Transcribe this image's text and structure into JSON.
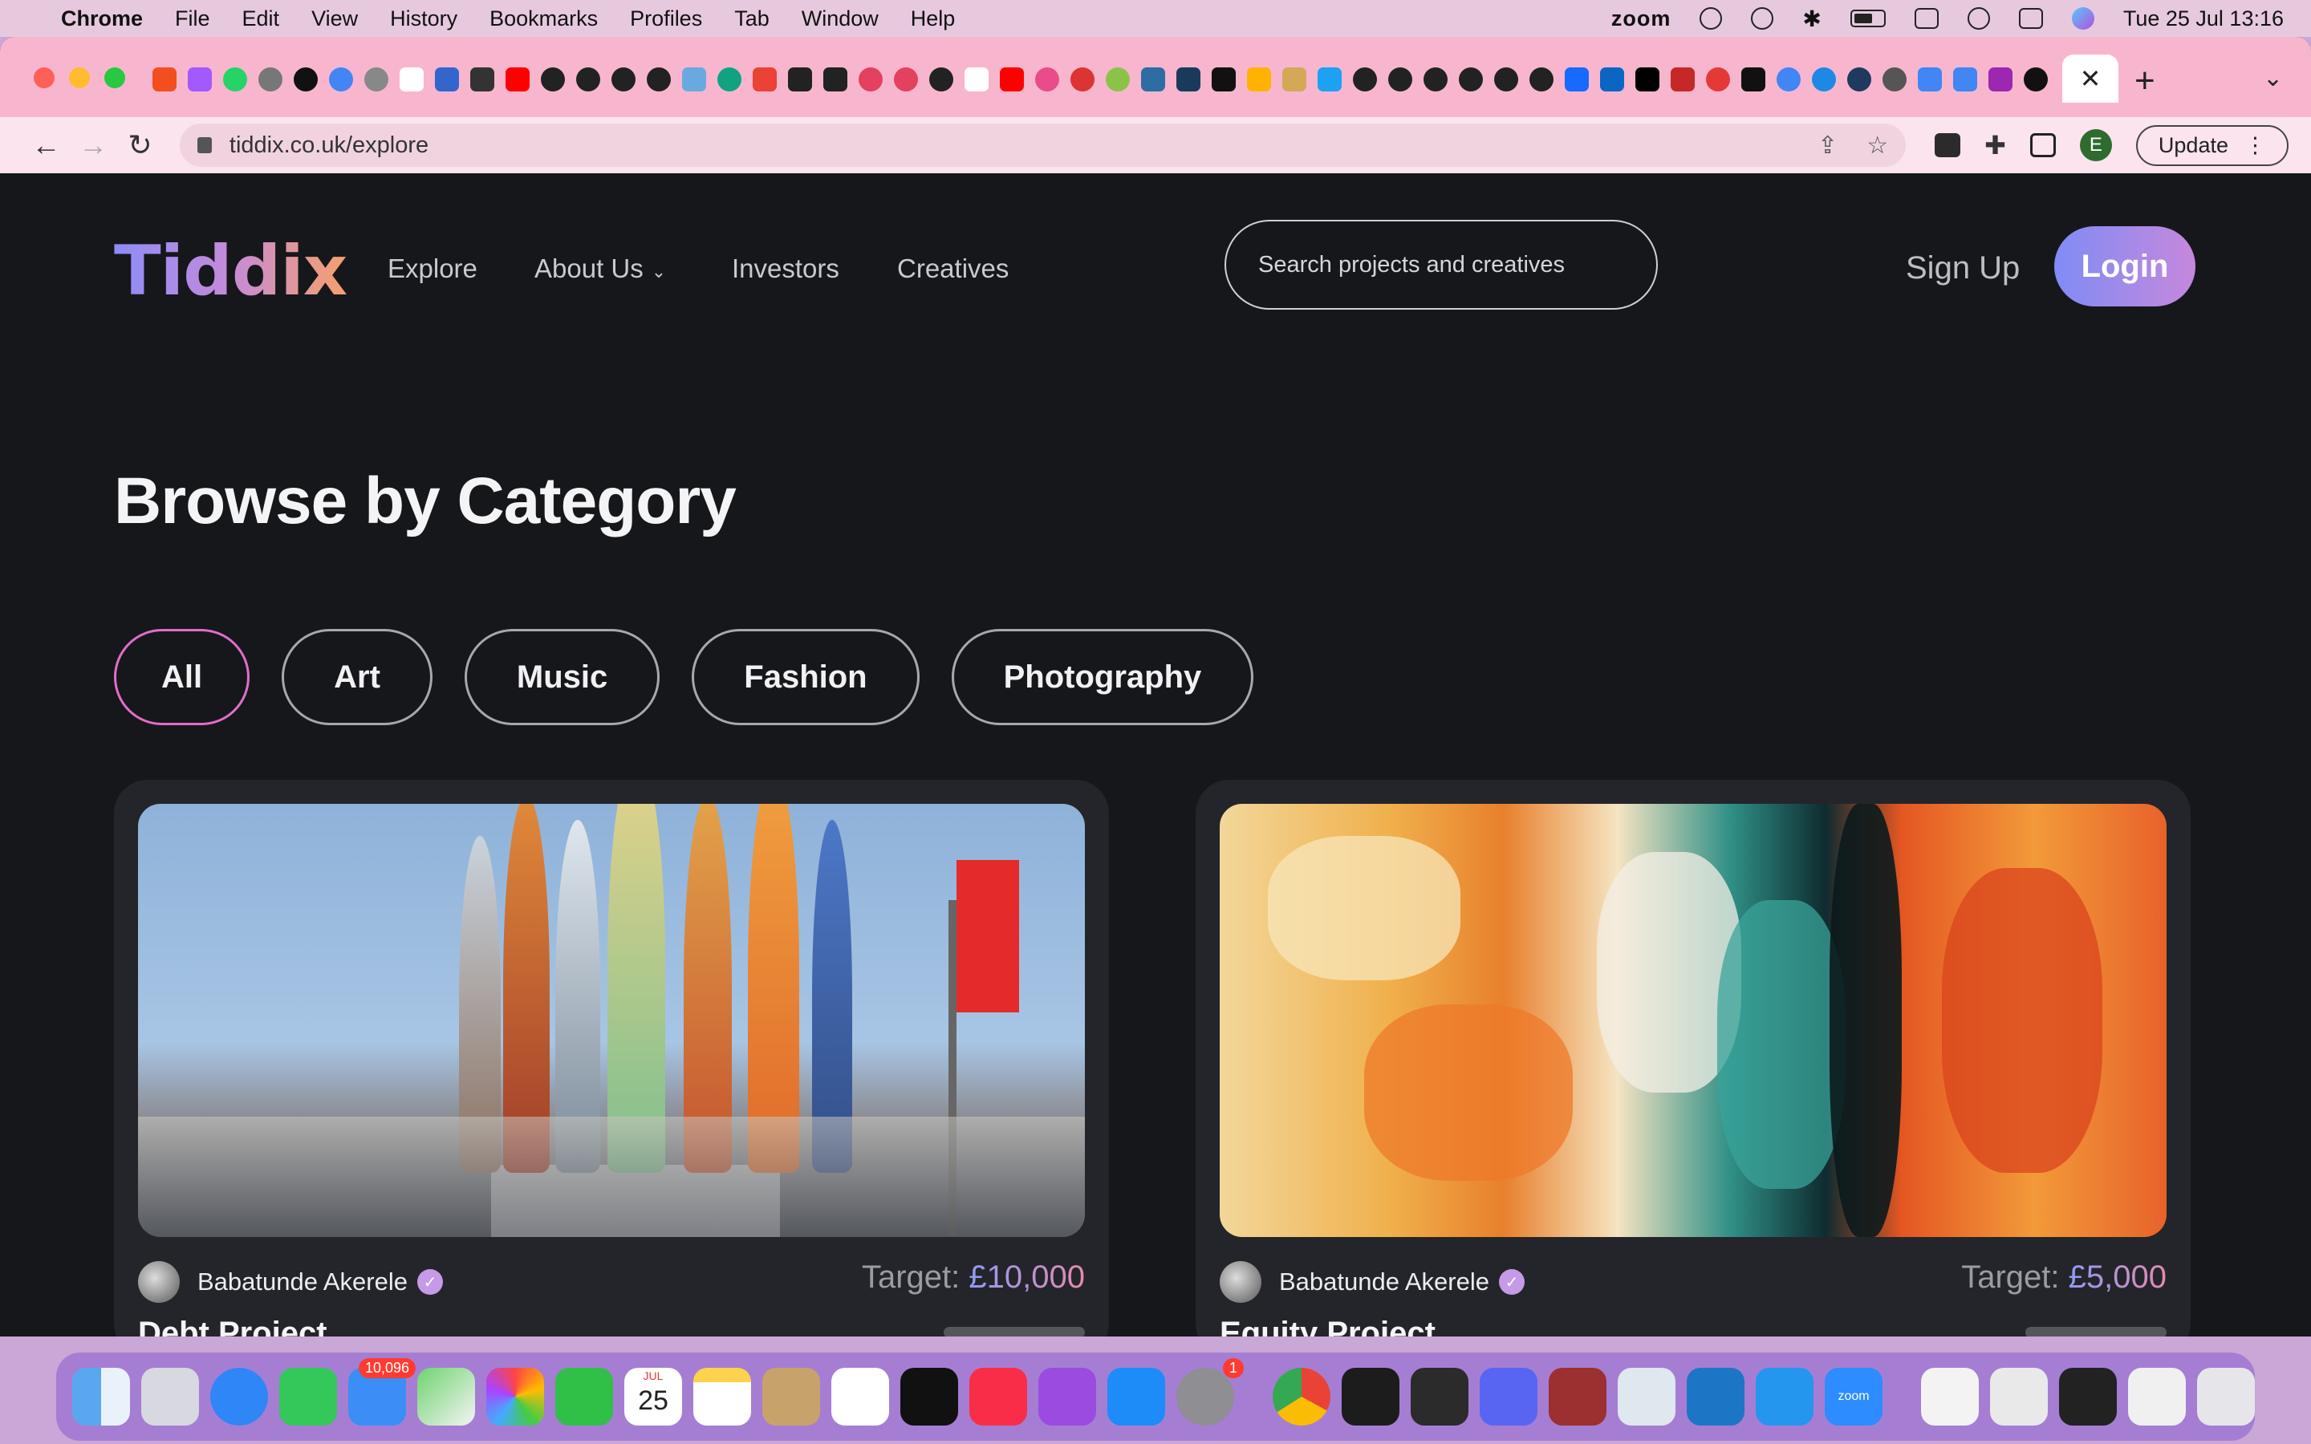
{
  "menubar": {
    "app_name": "Chrome",
    "items": [
      "File",
      "Edit",
      "View",
      "History",
      "Bookmarks",
      "Profiles",
      "Tab",
      "Window",
      "Help"
    ],
    "zoom_label": "zoom",
    "datetime": "Tue 25 Jul  13:16"
  },
  "browser": {
    "url": "tiddix.co.uk/explore",
    "update_label": "Update",
    "profile_initial": "E",
    "active_tab_close": "✕",
    "new_tab": "+",
    "tab_menu": "⌄"
  },
  "site": {
    "logo": "Tiddix",
    "nav": {
      "explore": "Explore",
      "about": "About Us",
      "investors": "Investors",
      "creatives": "Creatives"
    },
    "search_placeholder": "Search projects and creatives",
    "signup": "Sign Up",
    "login": "Login"
  },
  "browse": {
    "heading": "Browse by Category",
    "categories": [
      "All",
      "Art",
      "Music",
      "Fashion",
      "Photography"
    ],
    "active_category": "All"
  },
  "projects": [
    {
      "creator": "Babatunde Akerele",
      "target_label": "Target:",
      "target_amount": "£10,000",
      "title": "Debt Project",
      "progress": 0.0
    },
    {
      "creator": "Babatunde Akerele",
      "target_label": "Target:",
      "target_amount": "£5,000",
      "title": "Equity Project",
      "progress": 0.0
    }
  ],
  "dock": {
    "mail_badge": "10,096",
    "settings_badge": "1",
    "calendar_month": "JUL",
    "calendar_day": "25",
    "zoom_label": "zoom"
  },
  "colors": {
    "accent_start": "#7f8cf5",
    "accent_end": "#c688dc",
    "active_chip_border": "#e06ec8",
    "page_bg": "#16171b",
    "card_bg": "#24252a"
  }
}
